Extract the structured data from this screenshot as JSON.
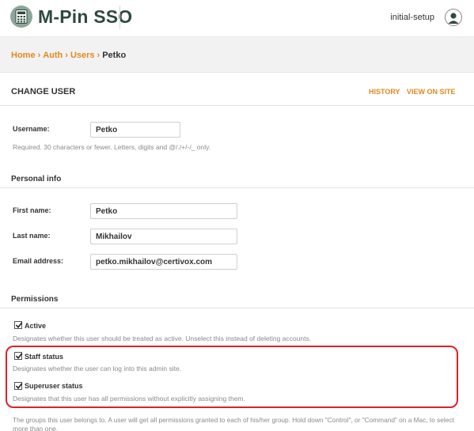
{
  "brand": {
    "name": "M-Pin SSO"
  },
  "header": {
    "user_link": "initial-setup"
  },
  "breadcrumbs": {
    "items": [
      "Home",
      "Auth",
      "Users"
    ],
    "separator": "›",
    "current": "Petko"
  },
  "page": {
    "title": "CHANGE USER",
    "tools": [
      "HISTORY",
      "VIEW ON SITE"
    ]
  },
  "form": {
    "username": {
      "label": "Username:",
      "value": "Petko",
      "help": "Required. 30 characters or fewer. Letters, digits and @/./+/-/_ only."
    },
    "personal_info": {
      "title": "Personal info",
      "first_name": {
        "label": "First name:",
        "value": "Petko"
      },
      "last_name": {
        "label": "Last name:",
        "value": "Mikhailov"
      },
      "email": {
        "label": "Email address:",
        "value": "petko.mikhailov@certivox.com"
      }
    },
    "permissions": {
      "title": "Permissions",
      "active": {
        "label": "Active",
        "checked": true,
        "help": "Designates whether this user should be treated as active. Unselect this instead of deleting accounts."
      },
      "staff": {
        "label": "Staff status",
        "checked": true,
        "help": "Designates whether the user can log into this admin site."
      },
      "superuser": {
        "label": "Superuser status",
        "checked": true,
        "help": "Designates that this user has all permissions without explicitly assigning them."
      },
      "groups_help_1": "The groups this user belongs to. A user will get all permissions granted to each of his/her group. Hold down \"Control\", or \"Command\" on a Mac, to select",
      "groups_help_2": "more than one."
    }
  },
  "colors": {
    "accent": "#e08a1e",
    "brand": "#2e4a3e",
    "highlight": "#e0202a"
  },
  "icons": {
    "logo": "calculator-logo-icon",
    "avatar": "user-avatar-icon",
    "check": "checkmark-icon"
  }
}
